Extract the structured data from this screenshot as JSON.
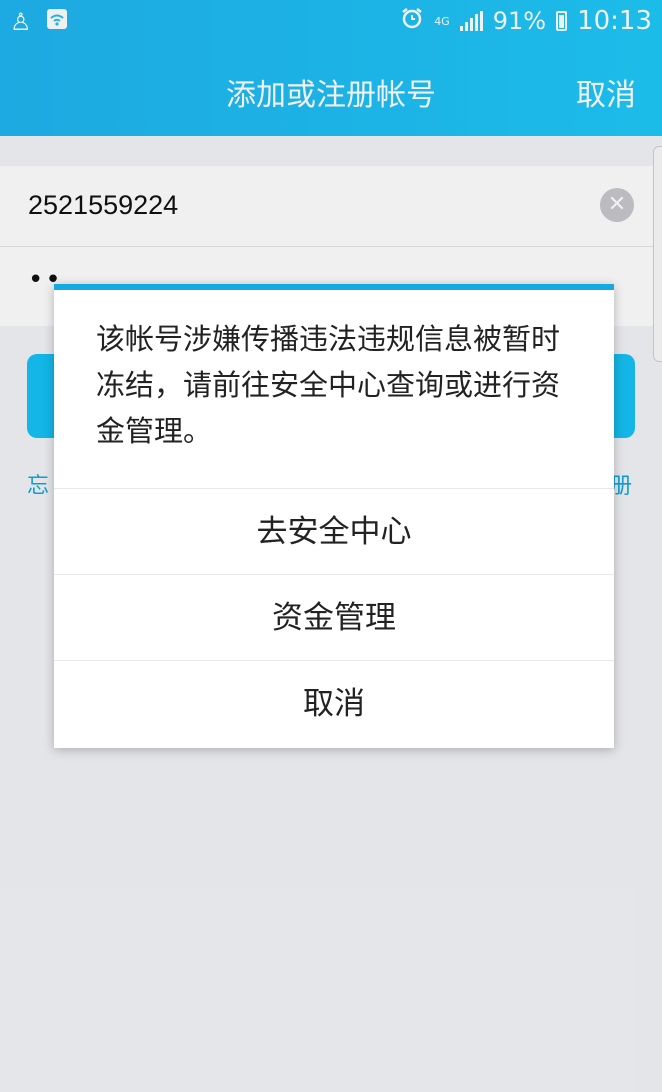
{
  "status_bar": {
    "left_icons": [
      "app-notification-icon",
      "wifi-icon"
    ],
    "network": "4G",
    "battery": "91%",
    "time": "10:13"
  },
  "header": {
    "title": "添加或注册帐号",
    "cancel_label": "取消"
  },
  "form": {
    "account_value": "2521559224",
    "password_value": "••",
    "forgot_link_partial": "忘",
    "register_link_partial": "册"
  },
  "dialog": {
    "message": "该帐号涉嫌传播违法违规信息被暂时冻结，请前往安全中心查询或进行资金管理。",
    "options": [
      {
        "label": "去安全中心"
      },
      {
        "label": "资金管理"
      },
      {
        "label": "取消"
      }
    ]
  },
  "colors": {
    "header_bg": "#1ec0f5",
    "accent": "#15a9e2",
    "login_button": "#15c2f5"
  }
}
